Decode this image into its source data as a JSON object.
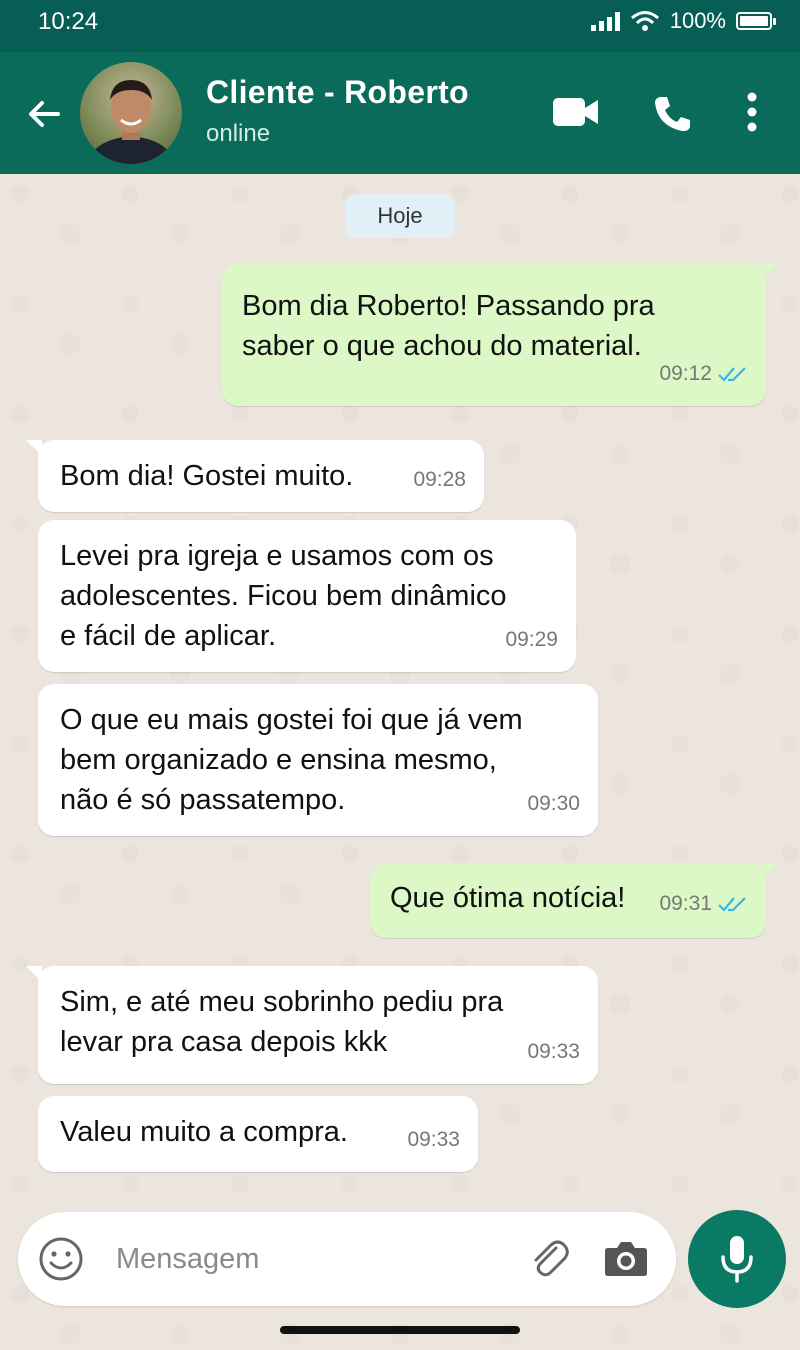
{
  "status_bar": {
    "time": "10:24",
    "battery": "100%",
    "battery_level": 1.0
  },
  "header": {
    "contact_name": "Cliente - Roberto",
    "contact_status": "online"
  },
  "chat": {
    "date_label": "Hoje",
    "messages": [
      {
        "direction": "out",
        "lines": [
          "Bom dia Roberto! Passando pra",
          "saber o que achou do material."
        ],
        "time": "09:12",
        "status": "read"
      },
      {
        "direction": "in",
        "lines": [
          "Bom dia! Gostei muito."
        ],
        "time": "09:28"
      },
      {
        "direction": "in",
        "lines": [
          "Levei pra igreja e usamos com os",
          "adolescentes. Ficou bem dinâmico",
          "e fácil de aplicar."
        ],
        "time": "09:29"
      },
      {
        "direction": "in",
        "lines": [
          "O que eu mais gostei foi que já vem",
          "bem organizado e ensina mesmo,",
          "não é só passatempo."
        ],
        "time": "09:30"
      },
      {
        "direction": "out",
        "lines": [
          "Que ótima notícia!"
        ],
        "time": "09:31",
        "status": "read"
      },
      {
        "direction": "in",
        "lines": [
          "Sim, e até meu sobrinho pediu pra",
          "levar pra casa depois kkk"
        ],
        "time": "09:33"
      },
      {
        "direction": "in",
        "lines": [
          "Valeu muito a compra."
        ],
        "time": "09:33"
      }
    ]
  },
  "input": {
    "placeholder": "Mensagem"
  },
  "icons": {
    "back": "arrow-left-icon",
    "video": "video-camera-icon",
    "call": "phone-icon",
    "menu": "more-vert-icon",
    "emoji": "emoji-icon",
    "attach": "paperclip-icon",
    "camera": "camera-icon",
    "mic": "microphone-icon",
    "read_receipt": "double-check-icon"
  },
  "colors": {
    "header": "#0b6b5b",
    "status_bar": "#075e54",
    "outgoing_bubble": "#dcf8c6",
    "incoming_bubble": "#ffffff",
    "read_check": "#34b7f1",
    "mic_button": "#0b7a64"
  }
}
